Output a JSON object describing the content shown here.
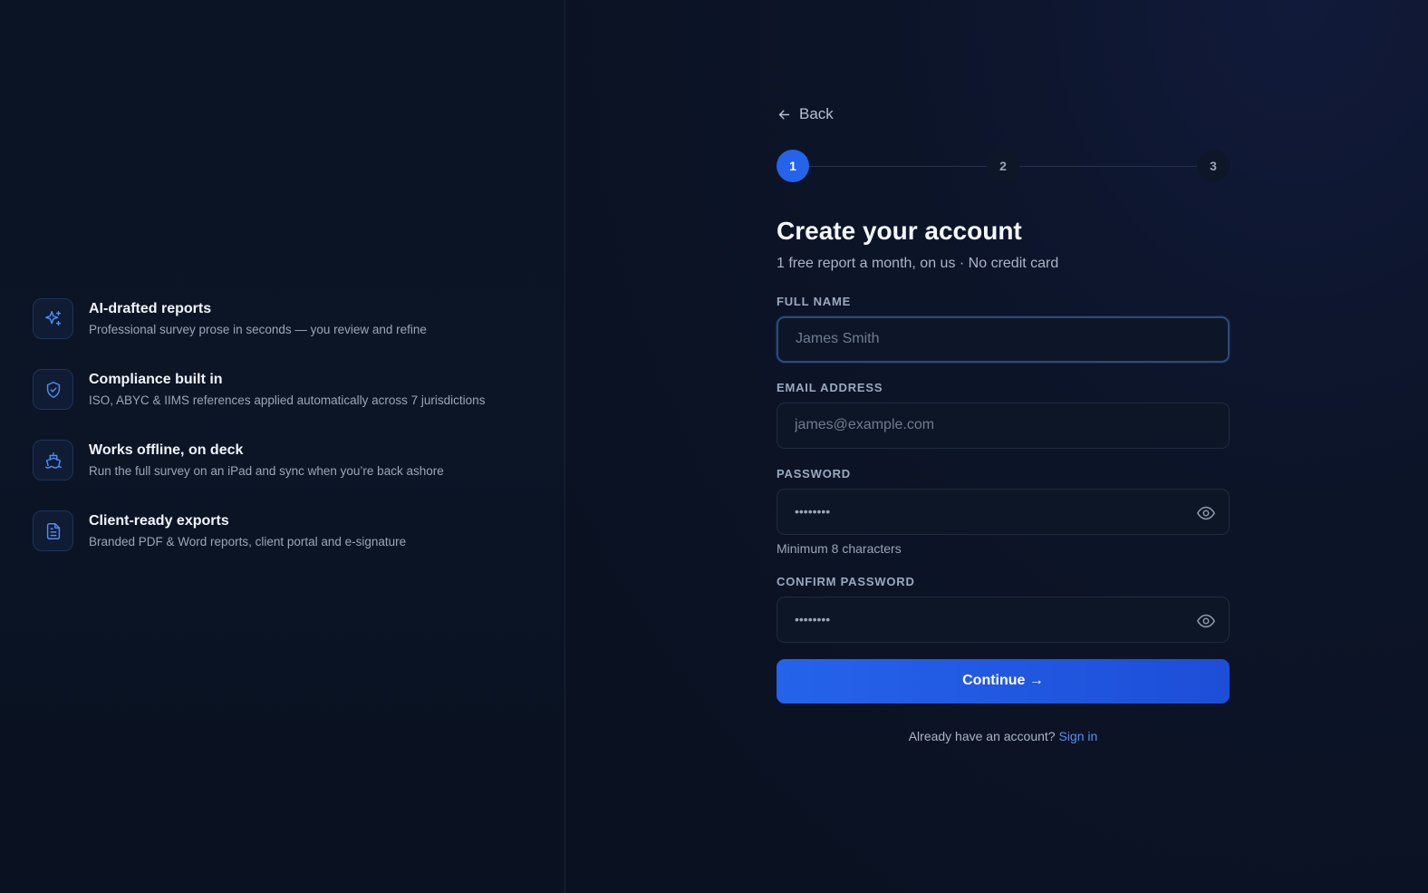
{
  "features": [
    {
      "icon": "sparkles-icon",
      "title": "AI-drafted reports",
      "desc": "Professional survey prose in seconds — you review and refine"
    },
    {
      "icon": "shield-check-icon",
      "title": "Compliance built in",
      "desc": "ISO, ABYC & IIMS references applied automatically across 7 jurisdictions"
    },
    {
      "icon": "ship-icon",
      "title": "Works offline, on deck",
      "desc": "Run the full survey on an iPad and sync when you’re back ashore"
    },
    {
      "icon": "file-text-icon",
      "title": "Client-ready exports",
      "desc": "Branded PDF & Word reports, client portal and e-signature"
    }
  ],
  "form": {
    "back_label": "Back",
    "steps": [
      "1",
      "2",
      "3"
    ],
    "active_step": 1,
    "title": "Create your account",
    "subtitle": "1 free report a month, on us · No credit card",
    "full_name": {
      "label": "FULL NAME",
      "placeholder": "James Smith",
      "value": ""
    },
    "email": {
      "label": "EMAIL ADDRESS",
      "placeholder": "james@example.com",
      "value": ""
    },
    "password": {
      "label": "PASSWORD",
      "value": "••••••••",
      "hint": "Minimum 8 characters"
    },
    "confirm_password": {
      "label": "CONFIRM PASSWORD",
      "value": "••••••••"
    },
    "continue_label": "Continue →",
    "signin_prompt": "Already have an account?",
    "signin_link": "Sign in"
  },
  "colors": {
    "accent": "#2563eb",
    "link": "#5b8ff0",
    "background": "#0a1120"
  }
}
